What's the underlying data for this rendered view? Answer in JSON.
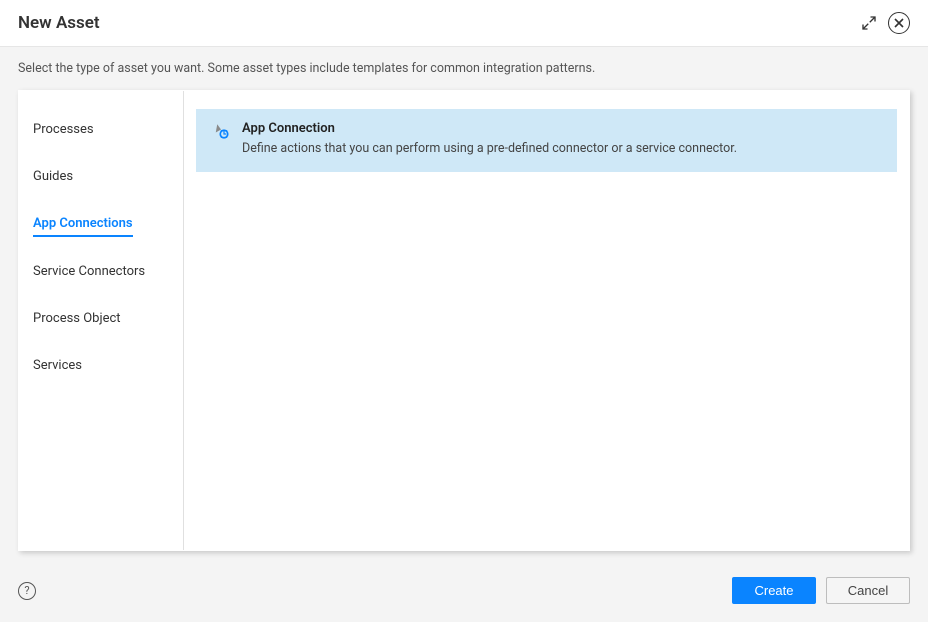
{
  "header": {
    "title": "New Asset"
  },
  "description": "Select the type of asset you want. Some asset types include templates for common integration patterns.",
  "sidebar": {
    "items": [
      {
        "label": "Processes",
        "active": false
      },
      {
        "label": "Guides",
        "active": false
      },
      {
        "label": "App Connections",
        "active": true
      },
      {
        "label": "Service Connectors",
        "active": false
      },
      {
        "label": "Process Object",
        "active": false
      },
      {
        "label": "Services",
        "active": false
      }
    ]
  },
  "card": {
    "title": "App Connection",
    "description": "Define actions that you can perform using a pre-defined connector or a service connector."
  },
  "footer": {
    "create_label": "Create",
    "cancel_label": "Cancel"
  }
}
